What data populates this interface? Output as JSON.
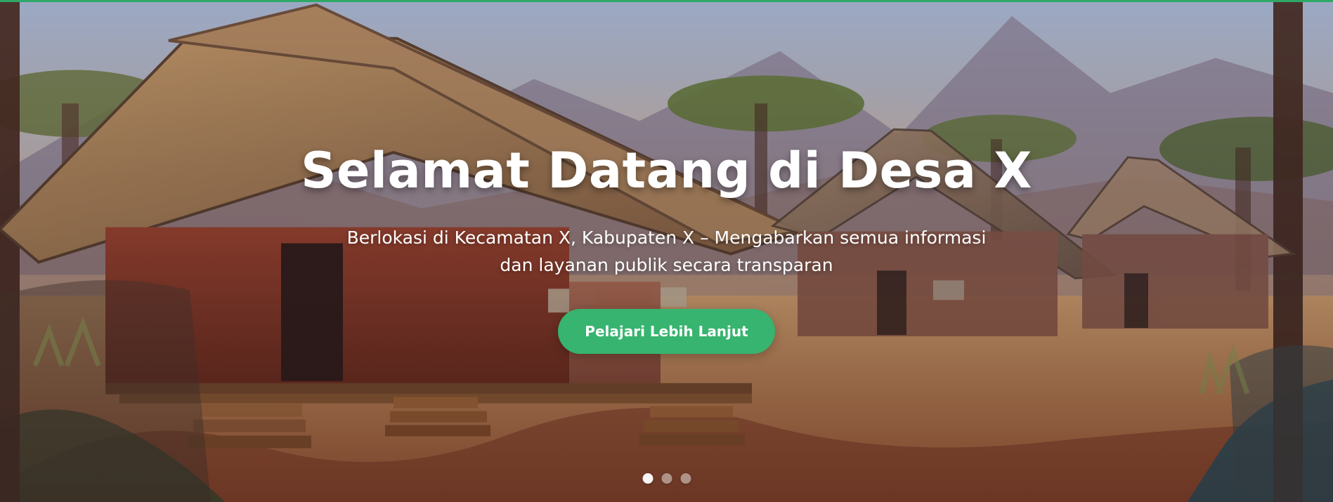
{
  "hero": {
    "title": "Selamat Datang di Desa X",
    "subtitle_line_1": "Berlokasi di Kecamatan X, Kabupaten X – Mengabarkan semua informasi",
    "subtitle_line_2": "dan layanan publik secara transparan",
    "button_label": "Pelajari Lebih Lanjut",
    "accent_color": "#37b46f"
  },
  "carousel": {
    "slides": 3,
    "active_slide": 1
  },
  "icons": {
    "background": "village-landscape-illustration",
    "indicator_dot": "carousel-dot-icon"
  }
}
